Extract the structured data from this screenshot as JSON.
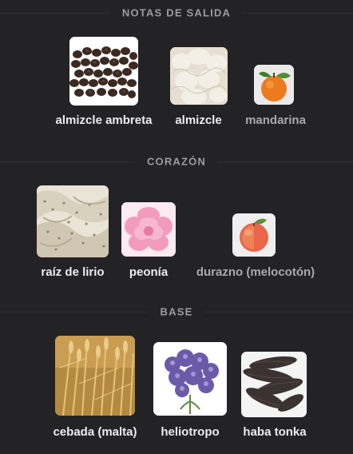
{
  "sections": [
    {
      "title": "NOTAS DE SALIDA",
      "notes": [
        {
          "label": "almizcle ambreta",
          "icon": "ambrette-seeds-icon"
        },
        {
          "label": "almizcle",
          "icon": "musk-fur-icon"
        },
        {
          "label": "mandarina",
          "icon": "mandarin-icon"
        }
      ]
    },
    {
      "title": "CORAZÓN",
      "notes": [
        {
          "label": "raíz de lirio",
          "icon": "orris-root-icon"
        },
        {
          "label": "peonía",
          "icon": "peony-icon"
        },
        {
          "label": "durazno (melocotón)",
          "icon": "peach-icon"
        }
      ]
    },
    {
      "title": "BASE",
      "notes": [
        {
          "label": "cebada (malta)",
          "icon": "barley-icon"
        },
        {
          "label": "heliotropo",
          "icon": "heliotrope-icon"
        },
        {
          "label": "haba tonka",
          "icon": "tonka-bean-icon"
        }
      ]
    }
  ],
  "colors": {
    "background": "#232325",
    "label_primary": "#ececed",
    "label_muted": "#a8a8ad",
    "section_title": "#9c9ca2",
    "divider": "#2f2f33"
  }
}
